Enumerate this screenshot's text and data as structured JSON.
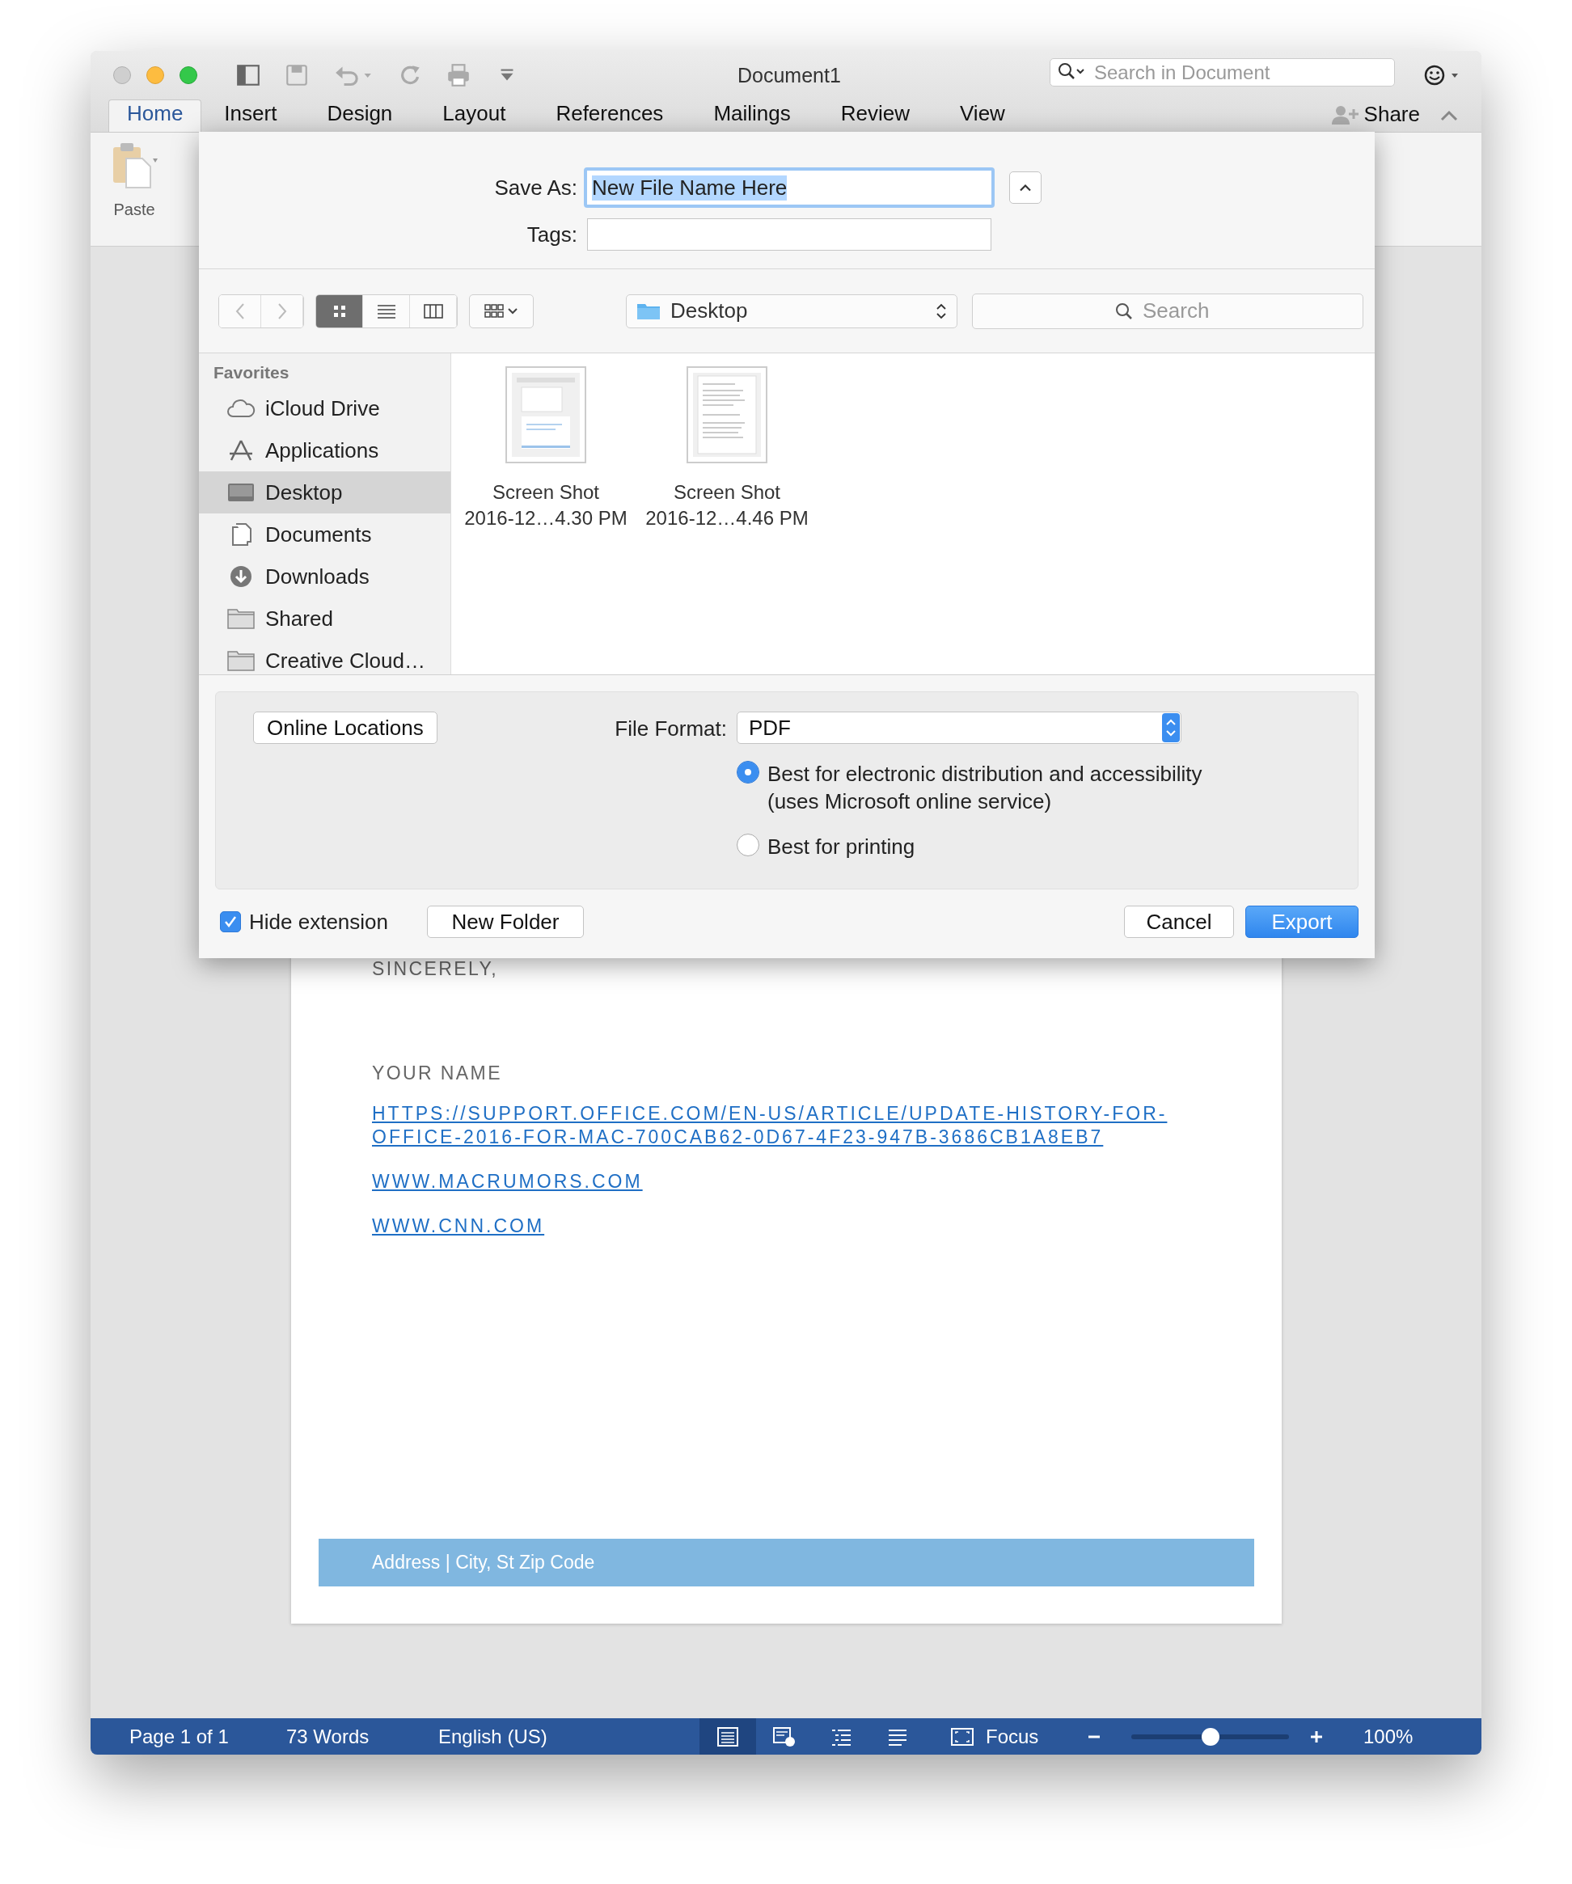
{
  "window": {
    "title": "Document1",
    "search": {
      "placeholder": "Search in Document"
    }
  },
  "ribbon_tabs": [
    {
      "label": "Home",
      "selected": true
    },
    {
      "label": "Insert",
      "selected": false
    },
    {
      "label": "Design",
      "selected": false
    },
    {
      "label": "Layout",
      "selected": false
    },
    {
      "label": "References",
      "selected": false
    },
    {
      "label": "Mailings",
      "selected": false
    },
    {
      "label": "Review",
      "selected": false
    },
    {
      "label": "View",
      "selected": false
    }
  ],
  "share": "Share",
  "ribbon": {
    "paste": "Paste"
  },
  "dialog": {
    "save_as_label": "Save As:",
    "save_as_value": "New File Name Here",
    "tags_label": "Tags:",
    "view_modes": [
      {
        "kind": "icons",
        "selected": true
      },
      {
        "kind": "list",
        "selected": false
      },
      {
        "kind": "columns",
        "selected": false
      }
    ],
    "location": "Desktop",
    "search": {
      "placeholder": "Search"
    },
    "sidebar": {
      "heading": "Favorites",
      "items": [
        {
          "label": "iCloud Drive",
          "kind": "cloud",
          "selected": false
        },
        {
          "label": "Applications",
          "kind": "apps",
          "selected": false
        },
        {
          "label": "Desktop",
          "kind": "desktop",
          "selected": true
        },
        {
          "label": "Documents",
          "kind": "documents",
          "selected": false
        },
        {
          "label": "Downloads",
          "kind": "downloads",
          "selected": false
        },
        {
          "label": "Shared",
          "kind": "folder",
          "selected": false
        },
        {
          "label": "Creative Cloud…",
          "kind": "folder",
          "selected": false
        }
      ]
    },
    "files": [
      {
        "lines": [
          "Screen Shot",
          "2016-12…4.30 PM"
        ]
      },
      {
        "lines": [
          "Screen Shot",
          "2016-12…4.46 PM"
        ]
      }
    ],
    "online_locations": "Online Locations",
    "file_format": {
      "label": "File Format:",
      "value": "PDF"
    },
    "options": [
      {
        "label": "Best for electronic distribution and accessibility",
        "note": "(uses Microsoft online service)",
        "selected": true
      },
      {
        "label": "Best for printing",
        "selected": false
      }
    ],
    "hide_extension": {
      "label": "Hide extension",
      "checked": true
    },
    "new_folder": "New Folder",
    "buttons": [
      {
        "label": "Cancel",
        "kind": "plain"
      },
      {
        "label": "Export",
        "kind": "default"
      }
    ]
  },
  "document": {
    "closing": "SINCERELY,",
    "name": "YOUR NAME",
    "links": [
      "HTTPS://SUPPORT.OFFICE.COM/EN-US/ARTICLE/UPDATE-HISTORY-FOR-OFFICE-2016-FOR-MAC-700CAB62-0D67-4F23-947B-3686CB1A8EB7",
      "WWW.MACRUMORS.COM",
      "WWW.CNN.COM"
    ],
    "footer": "Address | City, St Zip Code"
  },
  "status_bar": {
    "page": "Page 1 of 1",
    "words": "73 Words",
    "language": "English (US)",
    "views": [
      {
        "kind": "print",
        "selected": true
      },
      {
        "kind": "web",
        "selected": false
      },
      {
        "kind": "outline",
        "selected": false
      },
      {
        "kind": "draft",
        "selected": false
      }
    ],
    "focus": "Focus",
    "zoom": {
      "level": 0.5
    },
    "zoom_text": "100%"
  }
}
